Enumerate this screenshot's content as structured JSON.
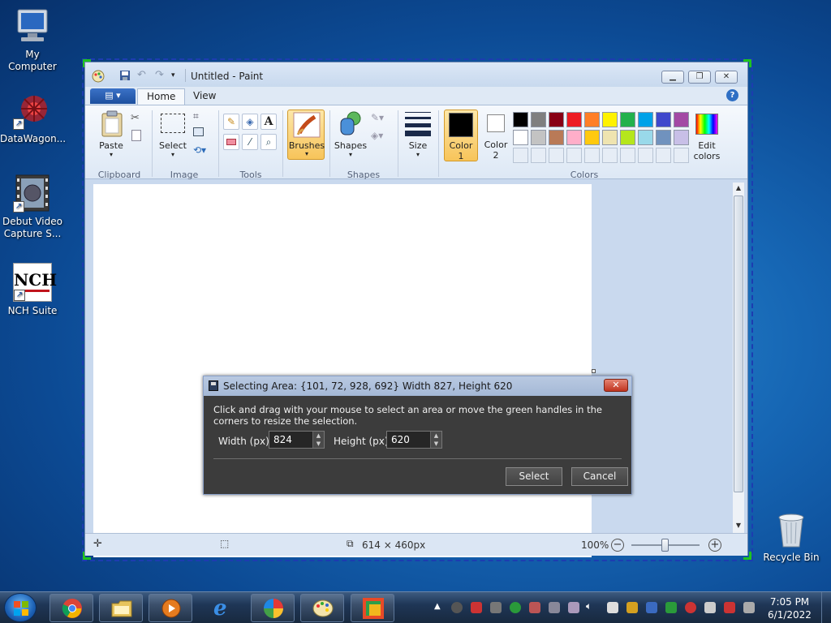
{
  "desktop": {
    "icons": [
      {
        "label": "My Computer"
      },
      {
        "label": "DataWagon..."
      },
      {
        "label": "Debut Video Capture S..."
      },
      {
        "label": "NCH Suite"
      },
      {
        "label": "Recycle Bin"
      }
    ],
    "nch_text": "NCH"
  },
  "paint": {
    "title": "Untitled - Paint",
    "tabs": [
      "Home",
      "View"
    ],
    "groups": {
      "clipboard": "Clipboard",
      "image": "Image",
      "tools": "Tools",
      "shapes": "Shapes",
      "colors": "Colors"
    },
    "buttons": {
      "paste": "Paste",
      "select": "Select",
      "brushes": "Brushes",
      "shapes": "Shapes",
      "size": "Size",
      "color1": "Color 1",
      "color2": "Color 2",
      "edit_colors": "Edit colors"
    },
    "palette_row1": [
      "#000000",
      "#7f7f7f",
      "#880015",
      "#ed1c24",
      "#ff7f27",
      "#fff200",
      "#22b14c",
      "#00a2e8",
      "#3f48cc",
      "#a349a4"
    ],
    "palette_row2": [
      "#ffffff",
      "#c3c3c3",
      "#b97a57",
      "#ffaec9",
      "#ffc90e",
      "#efe4b0",
      "#b5e61d",
      "#99d9ea",
      "#7092be",
      "#c8bfe7"
    ],
    "status": {
      "dimensions": "614 × 460px",
      "zoom": "100%"
    }
  },
  "dialog": {
    "title": "Selecting Area: {101, 72, 928, 692} Width 827, Height 620",
    "message": "Click and drag with your mouse to select an area or move the green handles in the corners to resize the selection.",
    "width_label": "Width (px):",
    "width_value": "824",
    "height_label": "Height (px):",
    "height_value": "620",
    "select_label": "Select",
    "cancel_label": "Cancel"
  },
  "taskbar": {
    "time": "7:05 PM",
    "date": "6/1/2022"
  }
}
